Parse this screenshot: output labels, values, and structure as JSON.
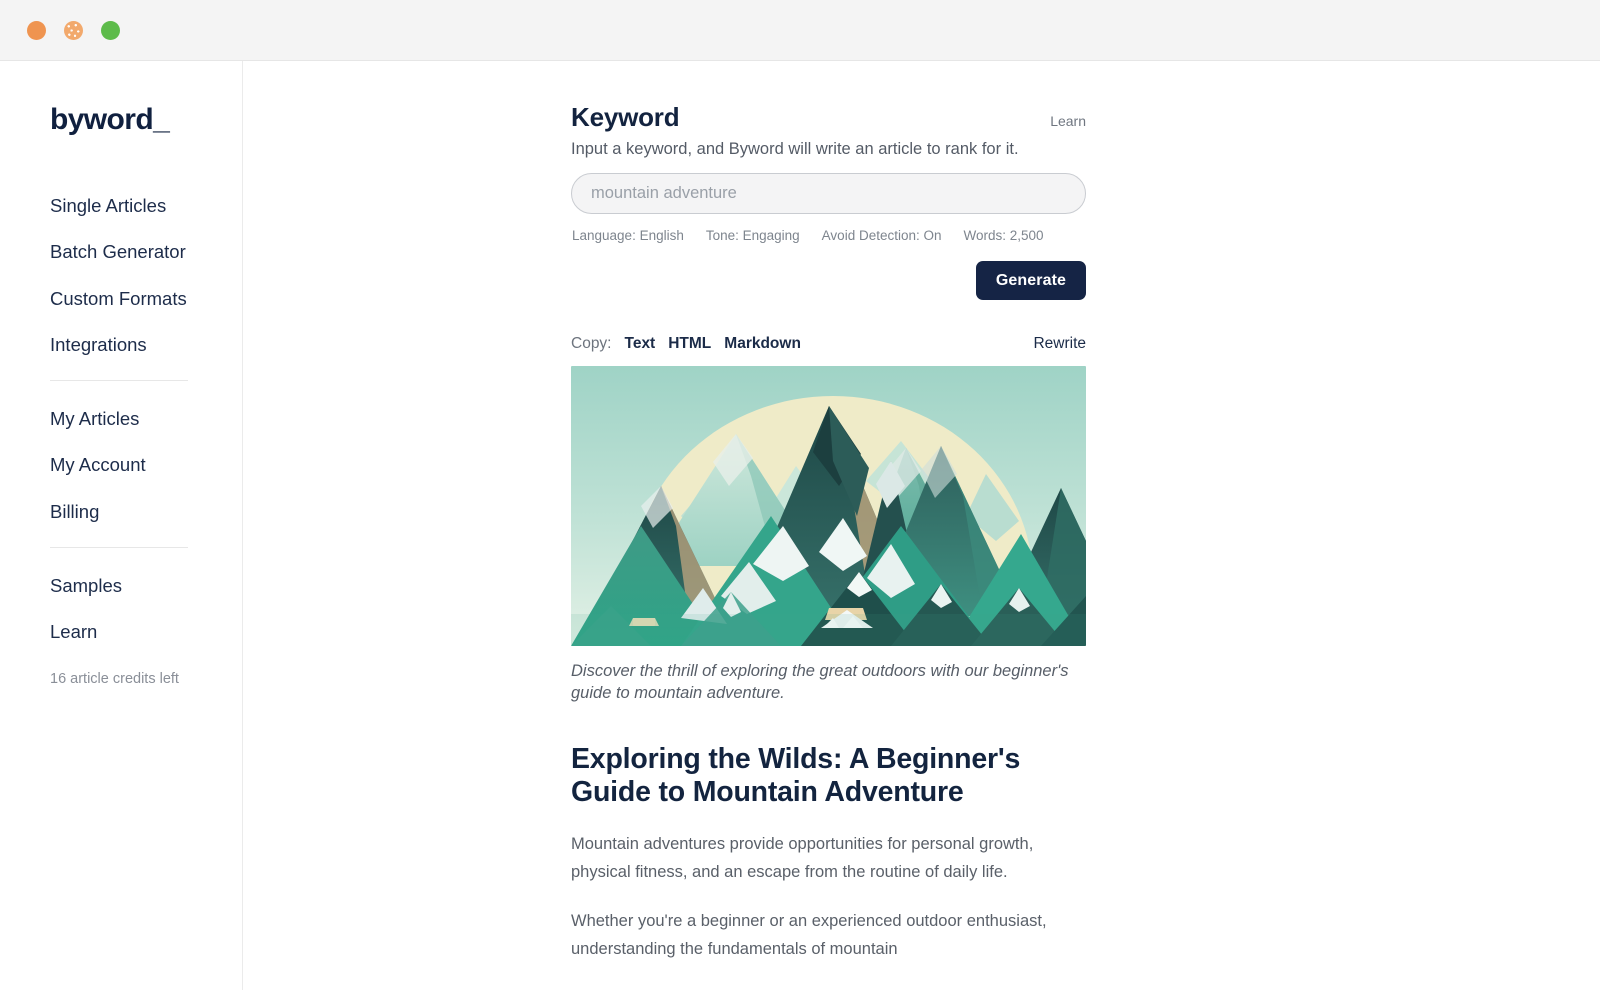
{
  "titlebar": {
    "dots": [
      "close-dot-orange",
      "minimize-dot-orange-dotted",
      "maximize-dot-green"
    ]
  },
  "sidebar": {
    "logo": "byword_",
    "group_one": [
      {
        "label": "Single Articles"
      },
      {
        "label": "Batch Generator"
      },
      {
        "label": "Custom Formats"
      },
      {
        "label": "Integrations"
      }
    ],
    "group_two": [
      {
        "label": "My Articles"
      },
      {
        "label": "My Account"
      },
      {
        "label": "Billing"
      }
    ],
    "group_three": [
      {
        "label": "Samples"
      },
      {
        "label": "Learn"
      }
    ],
    "credits": "16 article credits left"
  },
  "keyword_panel": {
    "title": "Keyword",
    "learn_label": "Learn",
    "subtitle": "Input a keyword, and Byword will write an article to rank for it.",
    "input_value": "",
    "input_placeholder": "mountain adventure",
    "meta": [
      "Language: English",
      "Tone: Engaging",
      "Avoid Detection: On",
      "Words: 2,500"
    ],
    "generate_label": "Generate"
  },
  "copy_bar": {
    "label": "Copy:",
    "options": [
      "Text",
      "HTML",
      "Markdown"
    ],
    "rewrite_label": "Rewrite"
  },
  "article": {
    "image_alt": "stylized teal mountain range illustration with pale sun",
    "caption": "Discover the thrill of exploring the great outdoors with our beginner's guide to mountain adventure.",
    "heading": "Exploring the Wilds: A Beginner's Guide to Mountain Adventure",
    "paragraphs": [
      "Mountain adventures provide opportunities for personal growth, physical fitness, and an escape from the routine of daily life.",
      "Whether you're a beginner or an experienced outdoor enthusiast, understanding the fundamentals of mountain"
    ]
  },
  "colors": {
    "brand_navy": "#13243f",
    "button_navy": "#152445",
    "titlebar_bg": "#f4f4f4",
    "dot_orange": "#ef9450",
    "dot_orange_light": "#f2a96c",
    "dot_green": "#5dbb4a",
    "muted_text": "#5a6069",
    "sky_teal": "#a9d9cc",
    "sun_cream": "#efebc8",
    "mountain_dark": "#2d5c59",
    "mountain_mid": "#49a08e",
    "mountain_light": "#a7d8c9",
    "snow": "#f2f7f6",
    "rock_tan": "#c2a780"
  }
}
